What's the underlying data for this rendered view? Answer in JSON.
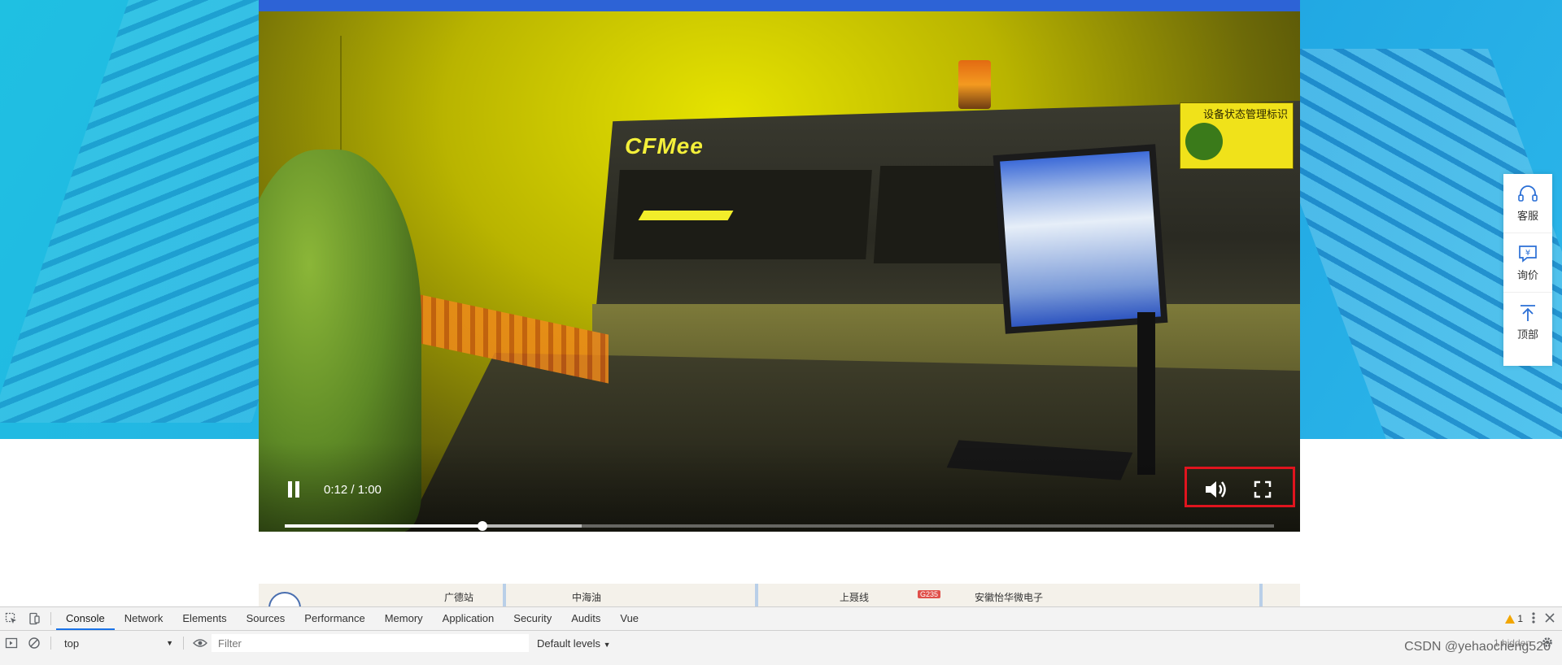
{
  "video": {
    "time_display": "0:12 / 1:00",
    "progress_fraction": 0.2,
    "buffered_fraction": 0.3,
    "logo_text": "CFMee",
    "tag_title": "设备状态管理标识"
  },
  "side_toolbar": {
    "items": [
      {
        "label": "客服",
        "icon": "headset-icon"
      },
      {
        "label": "询价",
        "icon": "inquiry-icon"
      },
      {
        "label": "顶部",
        "icon": "back-to-top-icon"
      }
    ]
  },
  "map": {
    "labels": [
      "广德站",
      "中海油",
      "上聂线",
      "G235",
      "安徽怡华微电子"
    ]
  },
  "devtools": {
    "tabs": [
      "Console",
      "Network",
      "Elements",
      "Sources",
      "Performance",
      "Memory",
      "Application",
      "Security",
      "Audits",
      "Vue"
    ],
    "active_tab": "Console",
    "warning_count": "1",
    "context": "top",
    "filter_placeholder": "Filter",
    "levels_label": "Default levels",
    "hidden_count": "1 hidden"
  },
  "watermark": "CSDN @yehaocheng520",
  "colors": {
    "highlight": "#e0141e",
    "devtools_active": "#1a73e8",
    "banner": "#23b4e3"
  }
}
